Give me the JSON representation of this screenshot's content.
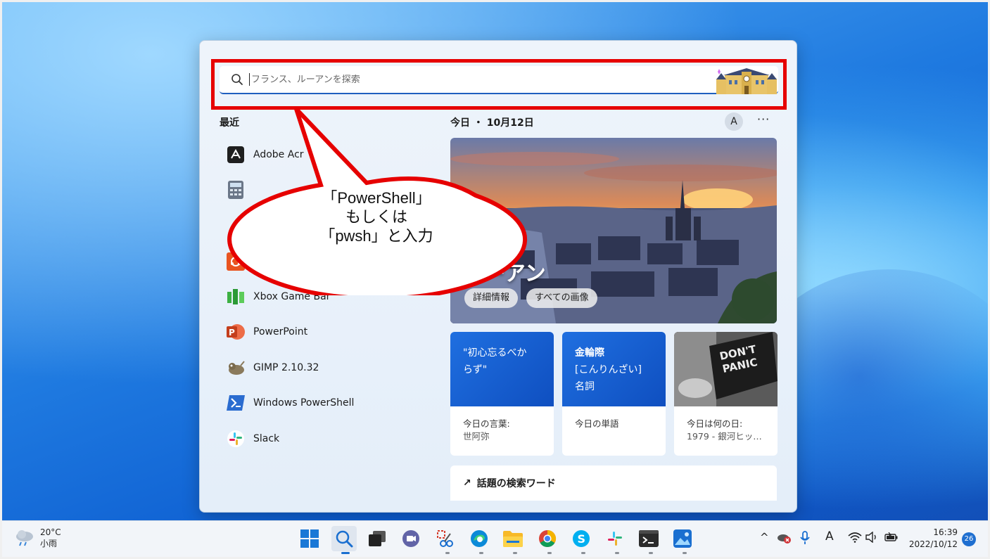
{
  "search": {
    "placeholder": "フランス、ルーアンを探索"
  },
  "recent": {
    "title": "最近",
    "apps": [
      {
        "label": "Adobe Acr",
        "icon": "adobe-acrobat-icon"
      },
      {
        "label": "",
        "icon": "calculator-icon"
      },
      {
        "label": "",
        "icon": "app-icon"
      },
      {
        "label": "U",
        "icon": "ubuntu-icon"
      },
      {
        "label": "Xbox Game Bar",
        "icon": "xbox-game-bar-icon"
      },
      {
        "label": "PowerPoint",
        "icon": "powerpoint-icon"
      },
      {
        "label": "GIMP 2.10.32",
        "icon": "gimp-icon"
      },
      {
        "label": "Windows PowerShell",
        "icon": "powershell-icon"
      },
      {
        "label": "Slack",
        "icon": "slack-icon"
      }
    ]
  },
  "today": {
    "title": "今日 ・ 10月12日",
    "account_initial": "A",
    "more": "···",
    "hero": {
      "title": "ルーアン",
      "details_button": "詳細情報",
      "images_button": "すべての画像"
    },
    "cards": [
      {
        "top_line1": "\"初心忘るべか",
        "top_line2": "らず\"",
        "top_line3": "",
        "bottom_line1": "今日の言葉:",
        "bottom_line2": "世阿弥"
      },
      {
        "top_line1": "金輪際",
        "top_line2": "[こんりんざい]",
        "top_line3": "名詞",
        "bottom_line1": "今日の単語",
        "bottom_line2": ""
      },
      {
        "top_line1": "DON'T",
        "top_line2": "PANIC",
        "top_line3": "",
        "bottom_line1": "今日は何の日:",
        "bottom_line2": "1979 - 銀河ヒッ…"
      }
    ],
    "trending": "話題の検索ワード"
  },
  "callout": {
    "line1": "「PowerShell」",
    "line2": "もしくは",
    "line3": "「pwsh」と入力"
  },
  "taskbar": {
    "weather_temp": "20°C",
    "weather_desc": "小雨",
    "apps": [
      "start-icon",
      "search-icon",
      "task-view-icon",
      "teams-chat-icon",
      "snipping-tool-icon",
      "edge-icon",
      "file-explorer-icon",
      "chrome-icon",
      "skype-icon",
      "slack-icon",
      "terminal-icon",
      "photos-icon"
    ],
    "tray": {
      "chevron": "^",
      "ime": "A"
    },
    "time": "16:39",
    "date": "2022/10/12",
    "notifications": "26"
  }
}
